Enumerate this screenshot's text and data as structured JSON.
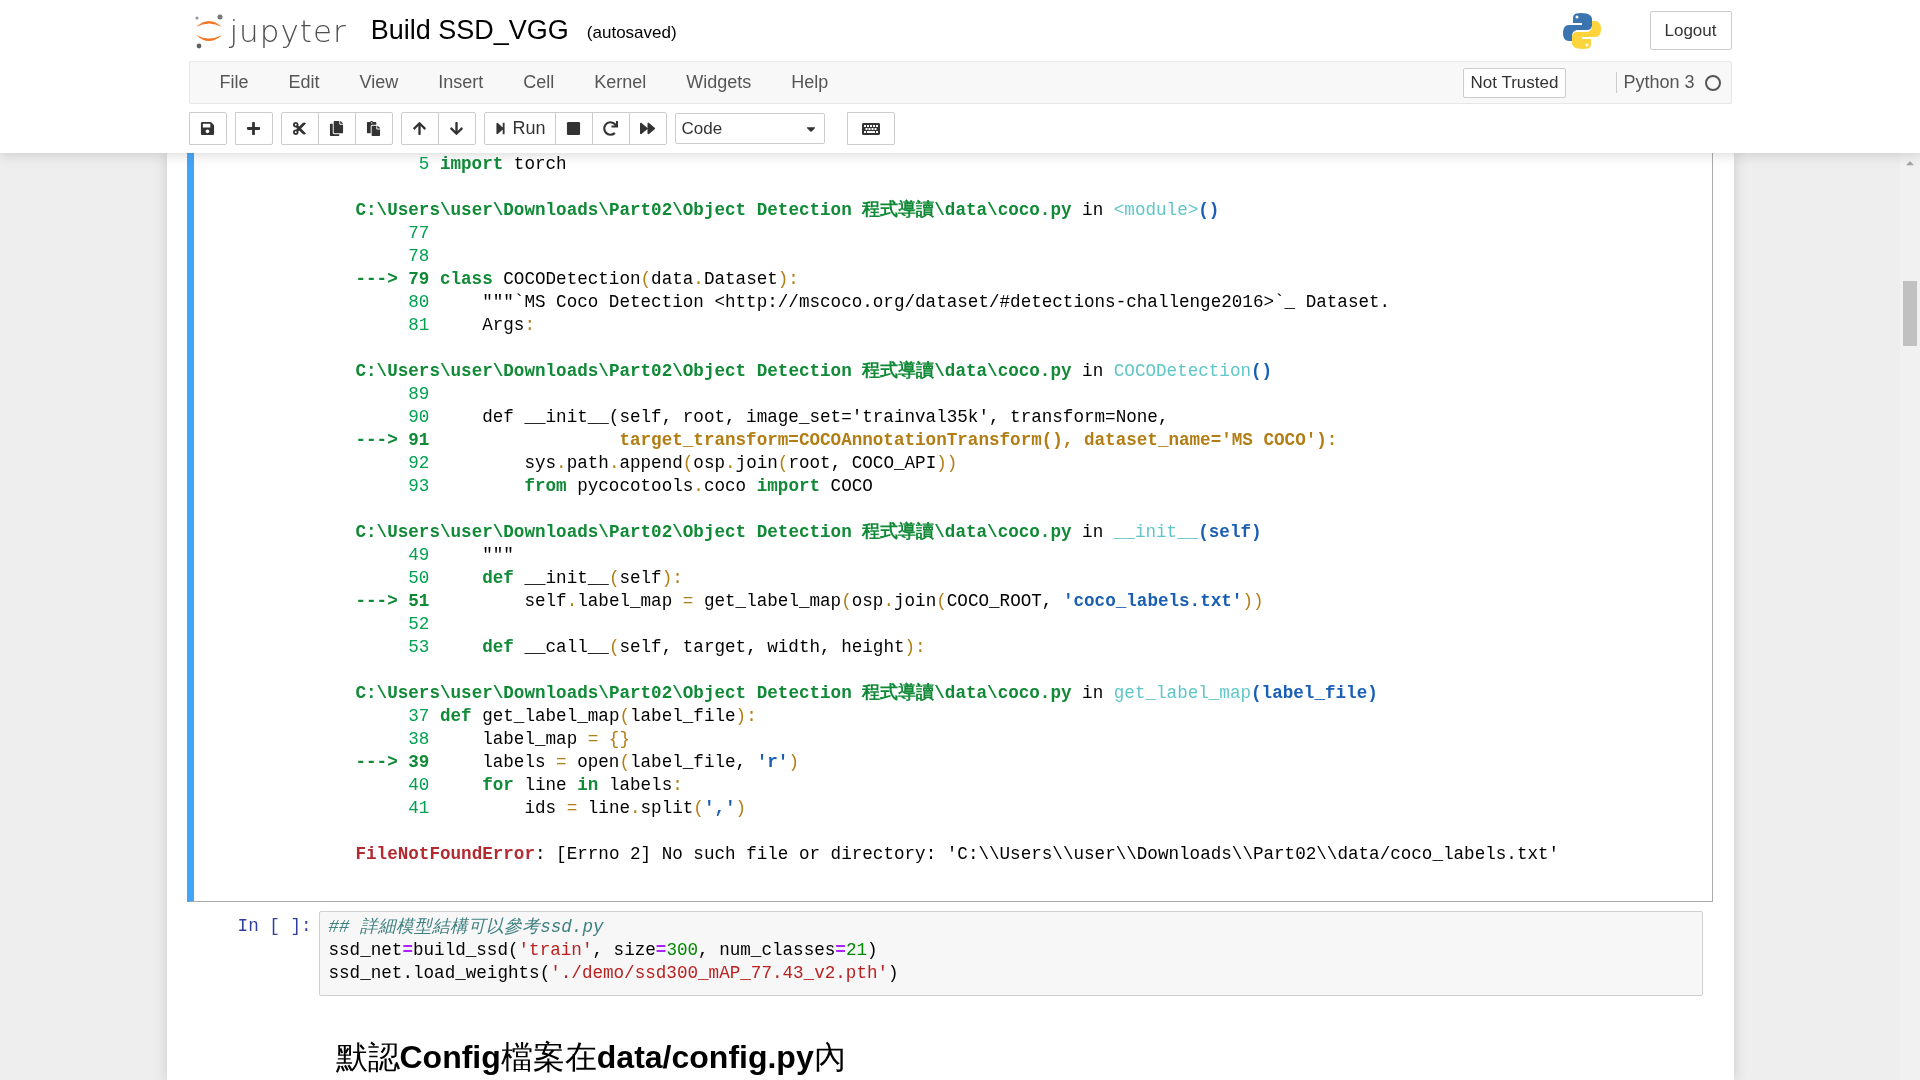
{
  "header": {
    "logo_text": "jupyter",
    "notebook_name": "Build SSD_VGG",
    "save_status": "(autosaved)",
    "logout": "Logout"
  },
  "menubar": {
    "menus": [
      "File",
      "Edit",
      "View",
      "Insert",
      "Cell",
      "Kernel",
      "Widgets",
      "Help"
    ],
    "trust": "Not Trusted",
    "kernel": {
      "name": "Python 3",
      "busy": false
    }
  },
  "toolbar": {
    "run_label": "Run",
    "cell_type": "Code"
  },
  "output_cell": {
    "selected": true,
    "frames": [
      {
        "lines": [
          {
            "number": "5",
            "code": [
              {
                "text": "import",
                "kind": "keyword"
              },
              {
                "text": " torch",
                "kind": "plain"
              }
            ]
          }
        ]
      },
      {
        "header": {
          "path": "C:\\Users\\user\\Downloads\\Part02\\Object Detection 程式導讀\\data\\coco.py",
          "word": " in ",
          "func": "<module>",
          "args": "()"
        },
        "lines": [
          {
            "number": "77"
          },
          {
            "number": "78"
          },
          {
            "marker": "--->",
            "number": "79",
            "code": [
              {
                "text": "class",
                "kind": "keyword"
              },
              {
                "text": " COCODetection",
                "kind": "plain"
              },
              {
                "text": "(",
                "kind": "punct"
              },
              {
                "text": "data",
                "kind": "plain"
              },
              {
                "text": ".",
                "kind": "punct"
              },
              {
                "text": "Dataset",
                "kind": "plain"
              },
              {
                "text": "):",
                "kind": "punct"
              }
            ]
          },
          {
            "number": "80",
            "code": [
              {
                "text": "    \"\"\"`MS Coco Detection <http://mscoco.org/dataset/#detections-challenge2016>`_ Dataset.",
                "kind": "plain"
              }
            ]
          },
          {
            "number": "81",
            "code": [
              {
                "text": "    Args",
                "kind": "plain"
              },
              {
                "text": ":",
                "kind": "punct"
              }
            ]
          }
        ]
      },
      {
        "header": {
          "path": "C:\\Users\\user\\Downloads\\Part02\\Object Detection 程式導讀\\data\\coco.py",
          "word": " in ",
          "func": "COCODetection",
          "args": "()"
        },
        "lines": [
          {
            "number": "89"
          },
          {
            "number": "90",
            "code": [
              {
                "text": "    def __init__(self, root, image_set='trainval35k', transform=None,",
                "kind": "plain"
              }
            ]
          },
          {
            "marker": "--->",
            "number": "91",
            "code": [
              {
                "text": "                 target_transform=COCOAnnotationTransform(), dataset_name='MS COCO'):",
                "kind": "highlight"
              }
            ]
          },
          {
            "number": "92",
            "code": [
              {
                "text": "        sys",
                "kind": "plain"
              },
              {
                "text": ".",
                "kind": "punct"
              },
              {
                "text": "path",
                "kind": "plain"
              },
              {
                "text": ".",
                "kind": "punct"
              },
              {
                "text": "append",
                "kind": "plain"
              },
              {
                "text": "(",
                "kind": "punct"
              },
              {
                "text": "osp",
                "kind": "plain"
              },
              {
                "text": ".",
                "kind": "punct"
              },
              {
                "text": "join",
                "kind": "plain"
              },
              {
                "text": "(",
                "kind": "punct"
              },
              {
                "text": "root, COCO_API",
                "kind": "plain"
              },
              {
                "text": "))",
                "kind": "punct"
              }
            ]
          },
          {
            "number": "93",
            "code": [
              {
                "text": "        from",
                "kind": "keyword"
              },
              {
                "text": " pycocotools",
                "kind": "plain"
              },
              {
                "text": ".",
                "kind": "punct"
              },
              {
                "text": "coco ",
                "kind": "plain"
              },
              {
                "text": "import",
                "kind": "keyword"
              },
              {
                "text": " COCO",
                "kind": "plain"
              }
            ]
          }
        ]
      },
      {
        "header": {
          "path": "C:\\Users\\user\\Downloads\\Part02\\Object Detection 程式導讀\\data\\coco.py",
          "word": " in ",
          "func": "__init__",
          "args": "(self)"
        },
        "lines": [
          {
            "number": "49",
            "code": [
              {
                "text": "    \"\"\"",
                "kind": "plain"
              }
            ]
          },
          {
            "number": "50",
            "code": [
              {
                "text": "    def",
                "kind": "keyword"
              },
              {
                "text": " __init__",
                "kind": "plain"
              },
              {
                "text": "(",
                "kind": "punct"
              },
              {
                "text": "self",
                "kind": "plain"
              },
              {
                "text": "):",
                "kind": "punct"
              }
            ]
          },
          {
            "marker": "--->",
            "number": "51",
            "code": [
              {
                "text": "        self",
                "kind": "plain"
              },
              {
                "text": ".",
                "kind": "punct"
              },
              {
                "text": "label_map ",
                "kind": "plain"
              },
              {
                "text": "=",
                "kind": "punct"
              },
              {
                "text": " get_label_map",
                "kind": "plain"
              },
              {
                "text": "(",
                "kind": "punct"
              },
              {
                "text": "osp",
                "kind": "plain"
              },
              {
                "text": ".",
                "kind": "punct"
              },
              {
                "text": "join",
                "kind": "plain"
              },
              {
                "text": "(",
                "kind": "punct"
              },
              {
                "text": "COCO_ROOT, ",
                "kind": "plain"
              },
              {
                "text": "'coco_labels.txt'",
                "kind": "string"
              },
              {
                "text": "))",
                "kind": "punct"
              }
            ]
          },
          {
            "number": "52"
          },
          {
            "number": "53",
            "code": [
              {
                "text": "    def",
                "kind": "keyword"
              },
              {
                "text": " __call__",
                "kind": "plain"
              },
              {
                "text": "(",
                "kind": "punct"
              },
              {
                "text": "self, target, width, height",
                "kind": "plain"
              },
              {
                "text": "):",
                "kind": "punct"
              }
            ]
          }
        ]
      },
      {
        "header": {
          "path": "C:\\Users\\user\\Downloads\\Part02\\Object Detection 程式導讀\\data\\coco.py",
          "word": " in ",
          "func": "get_label_map",
          "args": "(label_file)"
        },
        "lines": [
          {
            "number": "37",
            "code": [
              {
                "text": "def",
                "kind": "keyword"
              },
              {
                "text": " get_label_map",
                "kind": "plain"
              },
              {
                "text": "(",
                "kind": "punct"
              },
              {
                "text": "label_file",
                "kind": "plain"
              },
              {
                "text": "):",
                "kind": "punct"
              }
            ]
          },
          {
            "number": "38",
            "code": [
              {
                "text": "    label_map ",
                "kind": "plain"
              },
              {
                "text": "=",
                "kind": "punct"
              },
              {
                "text": " {}",
                "kind": "punct"
              }
            ]
          },
          {
            "marker": "--->",
            "number": "39",
            "code": [
              {
                "text": "    labels ",
                "kind": "plain"
              },
              {
                "text": "=",
                "kind": "punct"
              },
              {
                "text": " open",
                "kind": "plain"
              },
              {
                "text": "(",
                "kind": "punct"
              },
              {
                "text": "label_file, ",
                "kind": "plain"
              },
              {
                "text": "'r'",
                "kind": "string"
              },
              {
                "text": ")",
                "kind": "punct"
              }
            ]
          },
          {
            "number": "40",
            "code": [
              {
                "text": "    for",
                "kind": "keyword"
              },
              {
                "text": " line ",
                "kind": "plain"
              },
              {
                "text": "in",
                "kind": "keyword"
              },
              {
                "text": " labels",
                "kind": "plain"
              },
              {
                "text": ":",
                "kind": "punct"
              }
            ]
          },
          {
            "number": "41",
            "code": [
              {
                "text": "        ids ",
                "kind": "plain"
              },
              {
                "text": "=",
                "kind": "punct"
              },
              {
                "text": " line",
                "kind": "plain"
              },
              {
                "text": ".",
                "kind": "punct"
              },
              {
                "text": "split",
                "kind": "plain"
              },
              {
                "text": "(",
                "kind": "punct"
              },
              {
                "text": "','",
                "kind": "string"
              },
              {
                "text": ")",
                "kind": "punct"
              }
            ]
          }
        ]
      }
    ],
    "error": {
      "name": "FileNotFoundError",
      "message": ": [Errno 2] No such file or directory: 'C:\\\\Users\\\\user\\\\Downloads\\\\Part02\\\\data/coco_labels.txt'"
    }
  },
  "input_cell": {
    "selected": false,
    "prompt": "In [ ]:",
    "lines": [
      [
        {
          "text": "## 詳細模型結構可以參考ssd.py",
          "kind": "comment"
        }
      ],
      [
        {
          "text": "ssd_net",
          "kind": "plain"
        },
        {
          "text": "=",
          "kind": "op"
        },
        {
          "text": "build_ssd(",
          "kind": "plain"
        },
        {
          "text": "'train'",
          "kind": "literal"
        },
        {
          "text": ", size",
          "kind": "plain"
        },
        {
          "text": "=",
          "kind": "op"
        },
        {
          "text": "300",
          "kind": "number"
        },
        {
          "text": ", num_classes",
          "kind": "plain"
        },
        {
          "text": "=",
          "kind": "op"
        },
        {
          "text": "21",
          "kind": "number"
        },
        {
          "text": ")",
          "kind": "plain"
        }
      ],
      [
        {
          "text": "ssd_net.load_weights(",
          "kind": "plain"
        },
        {
          "text": "'./demo/ssd300_mAP_77.43_v2.pth'",
          "kind": "literal"
        },
        {
          "text": ")",
          "kind": "plain"
        }
      ]
    ]
  },
  "markdown_cell": {
    "heading": "默認**Config**檔案在**data/config.py**內"
  }
}
